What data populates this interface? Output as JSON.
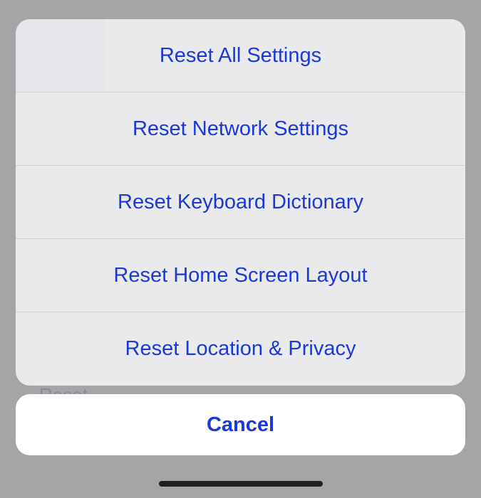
{
  "backdrop": {
    "text": "Reset"
  },
  "actionSheet": {
    "items": [
      {
        "label": "Reset All Settings"
      },
      {
        "label": "Reset Network Settings"
      },
      {
        "label": "Reset Keyboard Dictionary"
      },
      {
        "label": "Reset Home Screen Layout"
      },
      {
        "label": "Reset Location & Privacy"
      }
    ],
    "cancel": "Cancel"
  }
}
